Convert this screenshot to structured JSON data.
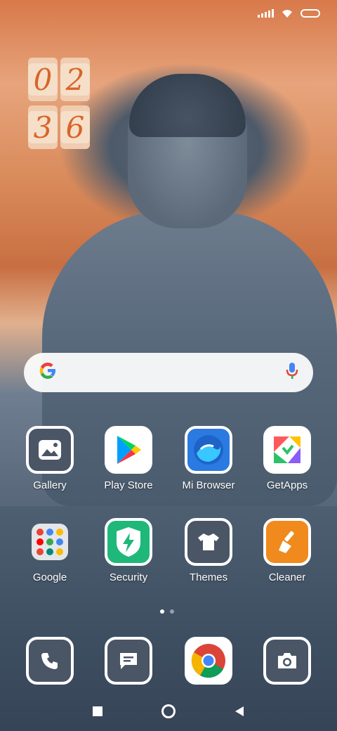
{
  "status_bar": {
    "icons": [
      "signal-icon",
      "wifi-icon",
      "battery-icon"
    ]
  },
  "clock_widget": {
    "digits": [
      "0",
      "2",
      "3",
      "6"
    ],
    "colors": {
      "digit_text": "#d9642a",
      "digit_bg": "#f5dfc8"
    }
  },
  "search_bar": {
    "logo_text": "G",
    "icons": [
      "google-logo-icon",
      "microphone-icon"
    ]
  },
  "apps_row1": [
    {
      "label": "Gallery",
      "icon": "gallery-icon"
    },
    {
      "label": "Play Store",
      "icon": "play-store-icon"
    },
    {
      "label": "Mi Browser",
      "icon": "mi-browser-icon"
    },
    {
      "label": "GetApps",
      "icon": "getapps-icon"
    }
  ],
  "apps_row2": [
    {
      "label": "Google",
      "icon": "google-folder-icon"
    },
    {
      "label": "Security",
      "icon": "security-icon"
    },
    {
      "label": "Themes",
      "icon": "themes-icon"
    },
    {
      "label": "Cleaner",
      "icon": "cleaner-icon"
    }
  ],
  "page_indicator": {
    "pages": 2,
    "current": 1
  },
  "dock": [
    {
      "icon": "phone-icon"
    },
    {
      "icon": "messages-icon"
    },
    {
      "icon": "chrome-icon"
    },
    {
      "icon": "camera-icon"
    }
  ],
  "nav_bar": {
    "icons": [
      "recents-icon",
      "home-icon",
      "back-icon"
    ]
  }
}
